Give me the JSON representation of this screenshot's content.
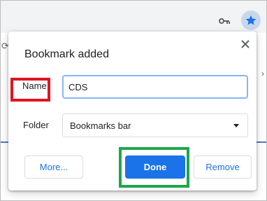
{
  "dialog": {
    "title": "Bookmark added",
    "name_label": "Name",
    "name_value": "CDS",
    "folder_label": "Folder",
    "folder_value": "Bookmarks bar",
    "buttons": {
      "more": "More...",
      "done": "Done",
      "remove": "Remove"
    }
  },
  "toolbar": {
    "icons": [
      "key-icon",
      "star-icon"
    ]
  },
  "colors": {
    "accent": "#1a73e8",
    "star_bg": "#c9d7ec",
    "highlight_red": "#e0141e",
    "highlight_green": "#1fa64a"
  }
}
